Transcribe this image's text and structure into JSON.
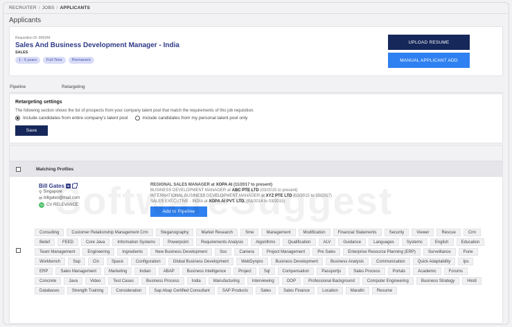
{
  "breadcrumb": {
    "items": [
      "RECRUITER",
      "JOBS"
    ],
    "current": "APPLICANTS"
  },
  "page": {
    "title": "Applicants"
  },
  "job": {
    "requisition_label": "Requisition ID: 806344",
    "title": "Sales And Business Development Manager - India",
    "department": "SALES",
    "tags": [
      "1 - 5 years",
      "Full-Time",
      "Permanent"
    ]
  },
  "actions": {
    "upload": "UPLOAD RESUME",
    "manual": "MANUAL APPLICANT ADD"
  },
  "tabs": {
    "pipeline": "Pipeline",
    "retargeting": "Retargeting"
  },
  "retargeting": {
    "heading": "Retargeting settings",
    "description": "The following section shows the list of prospects from your company talent pool that match the requirements of this job requisition.",
    "option_company": "Include candidates from entire company's talent pool",
    "option_personal": "Include candidates from my personal talent pool only",
    "save": "Save"
  },
  "results": {
    "header": "Matching Profiles"
  },
  "candidate": {
    "name": "Bill Gates",
    "location": "Singapore",
    "email": "billgates@mail.com",
    "relevance": "CV RELEVANCE",
    "relevance_badge": "CV",
    "experience": [
      {
        "role": "REGIONAL SALES MANAGER",
        "at": "at",
        "company": "XOPA AI",
        "period": "(11/2017 to present)"
      },
      {
        "role": "BUSINESS DEVELOPMENT MANAGER",
        "at": "at",
        "company": "ABC PTE LTD",
        "period": "(03/2015 to present)"
      },
      {
        "role": "INTERNATIONAL BUSINESS DEVELOPMENT MANAGER",
        "at": "at",
        "company": "XYZ PTE LTD",
        "period": "(03/2015 to 10/2017)"
      },
      {
        "role": "SALES EXECUTIVE - INDIA",
        "at": "at",
        "company": "XOPA AI PVT. LTD.",
        "period": "(03/2014 to 03/2015)"
      }
    ],
    "add_button": "Add to Pipeline",
    "skills": [
      "Consulting",
      "Customer Relationship Management Crm",
      "Steganography",
      "Market Research",
      "Sme",
      "Management",
      "Modification",
      "Financial Statements",
      "Security",
      "Viewer",
      "Rescue",
      "Crm",
      "Belief",
      "FEED",
      "Core Java",
      "Information Systems",
      "Powerpoint",
      "Requirements Analysis",
      "Algorithms",
      "Qualification",
      "ALV",
      "Guidance",
      "Languages",
      "Systemc",
      "English",
      "Education",
      "Team Management",
      "Engineering",
      "Ingredients",
      "New Business Development",
      "Soc",
      "Camera",
      "Project Management",
      "Pre Sales",
      "Enterprise Resource Planning (ERP)",
      "Surveillance",
      "Pune",
      "Workbench",
      "Sap",
      "Cin",
      "Space",
      "Configuration",
      "Global Business Development",
      "WebDynpro",
      "Business Development",
      "Business Analysis",
      "Communication",
      "Quick Adaptability",
      "Ips",
      "ERP",
      "Sales Management",
      "Marketing",
      "Indian",
      "ABAP",
      "Business Intelligence",
      "Project",
      "Sql",
      "Compensation",
      "Passportjs",
      "Sales Process",
      "Portals",
      "Academic",
      "Forums",
      "Concrete",
      "Java",
      "Video",
      "Test Cases",
      "Business Process",
      "India",
      "Manufacturing",
      "Interviewing",
      "OOP",
      "Professional Background",
      "Computer Engineering",
      "Business Strategy",
      "Hindi",
      "Databases",
      "Strength Training",
      "Consideration",
      "Sap Abap Certified Consultant",
      "SAP Products",
      "Sales",
      "Sales Finance",
      "Location",
      "Marathi",
      "Resume"
    ]
  },
  "watermark": "SoftwareSuggest",
  "colors": {
    "navy": "#16275a",
    "blue": "#2f80f0",
    "title": "#2e3a87"
  }
}
